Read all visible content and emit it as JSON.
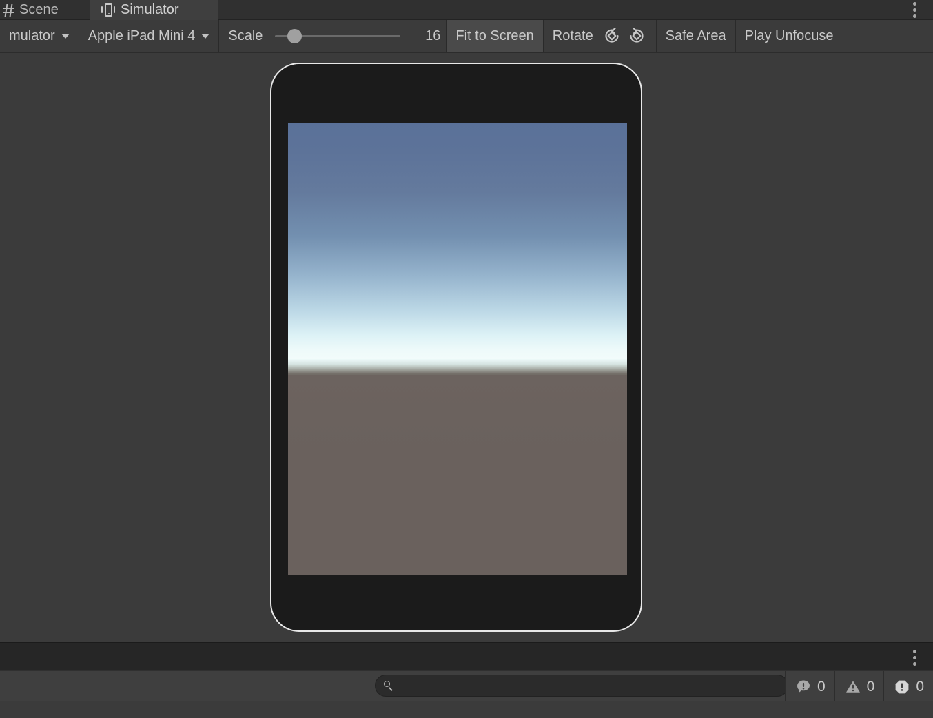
{
  "tabs": [
    {
      "label": "Scene",
      "icon": "scene-grid-icon",
      "active": false
    },
    {
      "label": "Simulator",
      "icon": "device-icon",
      "active": true
    }
  ],
  "toolbar": {
    "simulator_dropdown": "mulator",
    "device_dropdown": "Apple iPad Mini 4",
    "scale_label": "Scale",
    "scale_value": "16",
    "scale_percent": 15,
    "fit_to_screen": "Fit to Screen",
    "rotate_label": "Rotate",
    "rotate_ccw_icon": "rotate-counterclockwise-icon",
    "rotate_cw_icon": "rotate-clockwise-icon",
    "safe_area": "Safe Area",
    "play_unfocused": "Play Unfocuse"
  },
  "device_preview": {
    "device_name": "Apple iPad Mini 4",
    "sky_top_color": "#5a7199",
    "sky_horizon_color": "#f3fcfb",
    "ground_color": "#6a615d",
    "bezel_color": "#1b1b1b",
    "frame_outline_color": "#e8e8e8"
  },
  "console": {
    "search_placeholder": "",
    "search_value": "",
    "search_icon": "search-icon",
    "counters": [
      {
        "name": "info",
        "icon": "info-bubble-icon",
        "count": "0"
      },
      {
        "name": "warning",
        "icon": "warning-triangle-icon",
        "count": "0"
      },
      {
        "name": "error",
        "icon": "error-octagon-icon",
        "count": "0"
      }
    ]
  },
  "menus": {
    "tab_overflow": "tab-overflow-menu",
    "console_overflow": "console-overflow-menu"
  }
}
